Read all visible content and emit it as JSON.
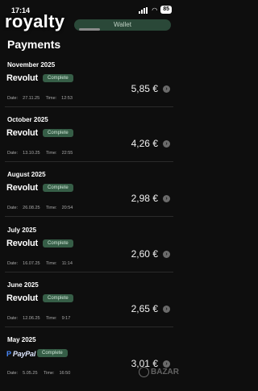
{
  "status": {
    "time": "17:14",
    "battery": "85"
  },
  "overlay": {
    "title": "royalty",
    "sheet_label": "Wallet"
  },
  "page": {
    "title": "Payments"
  },
  "sections": [
    {
      "month": "November 2025",
      "provider": "Revolut",
      "status": "Complete",
      "amount": "5,85 €",
      "date_label": "Date:",
      "date": "27.11.25",
      "time_label": "Time:",
      "time": "12:53"
    },
    {
      "month": "October 2025",
      "provider": "Revolut",
      "status": "Complete",
      "amount": "4,26 €",
      "date_label": "Date:",
      "date": "13.10.25",
      "time_label": "Time:",
      "time": "22:55"
    },
    {
      "month": "August 2025",
      "provider": "Revolut",
      "status": "Complete",
      "amount": "2,98 €",
      "date_label": "Date:",
      "date": "26.08.25",
      "time_label": "Time:",
      "time": "20:54"
    },
    {
      "month": "July 2025",
      "provider": "Revolut",
      "status": "Complete",
      "amount": "2,60 €",
      "date_label": "Date:",
      "date": "16.07.25",
      "time_label": "Time:",
      "time": "11:14"
    },
    {
      "month": "June 2025",
      "provider": "Revolut",
      "status": "Complete",
      "amount": "2,65 €",
      "date_label": "Date:",
      "date": "12.06.25",
      "time_label": "Time:",
      "time": "9:17"
    },
    {
      "month": "May 2025",
      "provider": "PayPal",
      "status": "Complete",
      "amount": "3,01 €",
      "date_label": "Date:",
      "date": "5.05.25",
      "time_label": "Time:",
      "time": "16:50"
    }
  ],
  "watermark": {
    "text": "BAZAR"
  }
}
